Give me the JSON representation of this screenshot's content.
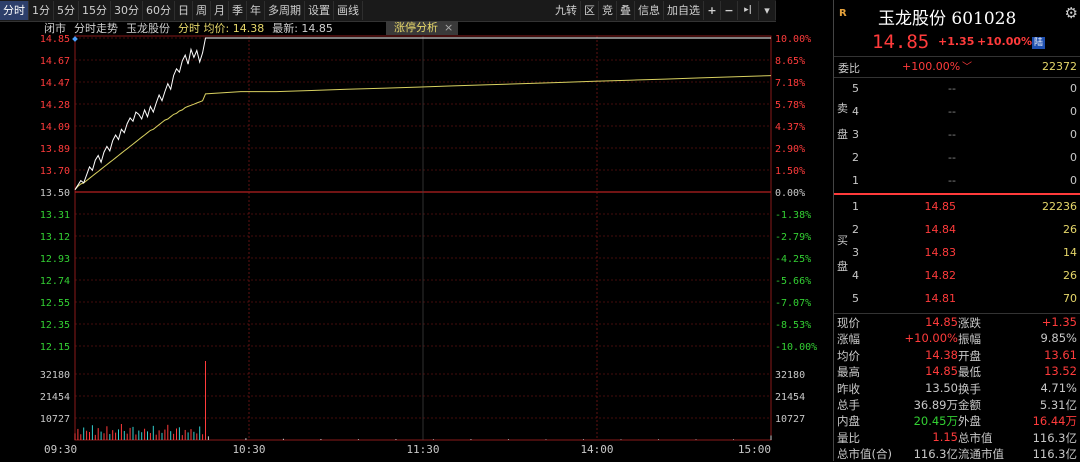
{
  "toolbar": {
    "left": [
      {
        "label": "分时",
        "active": true
      },
      {
        "label": "1分"
      },
      {
        "label": "5分"
      },
      {
        "label": "15分"
      },
      {
        "label": "30分"
      },
      {
        "label": "60分"
      },
      {
        "label": "日"
      },
      {
        "label": "周"
      },
      {
        "label": "月"
      },
      {
        "label": "季"
      },
      {
        "label": "年"
      },
      {
        "label": "多周期"
      },
      {
        "label": "设置"
      },
      {
        "label": "画线"
      }
    ],
    "right": [
      {
        "label": "九转"
      },
      {
        "label": "区"
      },
      {
        "label": "竞"
      },
      {
        "label": "叠"
      },
      {
        "label": "信息"
      },
      {
        "label": "加自选"
      }
    ],
    "icons": {
      "plus": "+",
      "minus": "−",
      "skip": "▸|",
      "menu": "▾"
    }
  },
  "infoline": {
    "status": "闭市",
    "mode": "分时走势",
    "name": "玉龙股份",
    "avg_label": "分时 均价: 14.38",
    "latest_label": "最新: 14.85"
  },
  "limitup_tab": {
    "label": "涨停分析",
    "close": "×"
  },
  "chart_data": {
    "type": "line",
    "price_axis": {
      "labels": [
        "14.85",
        "14.67",
        "14.47",
        "14.28",
        "14.09",
        "13.89",
        "13.70",
        "13.50",
        "13.31",
        "13.12",
        "12.93",
        "12.74",
        "12.55",
        "12.35",
        "12.15"
      ],
      "min": 12.15,
      "max": 14.85,
      "prev_close": 13.5
    },
    "pct_axis": {
      "labels": [
        "10.00%",
        "8.65%",
        "7.18%",
        "5.78%",
        "4.37%",
        "2.90%",
        "1.50%",
        "0.00%",
        "-1.38%",
        "-2.79%",
        "-4.25%",
        "-5.66%",
        "-7.07%",
        "-8.53%",
        "-10.00%"
      ]
    },
    "volume_axis": {
      "labels": [
        "32180",
        "21454",
        "10727"
      ],
      "max": 42907
    },
    "time_axis": {
      "labels": [
        "09:30",
        "10:30",
        "11:30",
        "14:00",
        "15:00"
      ]
    },
    "price": [
      13.52,
      13.56,
      13.6,
      13.58,
      13.65,
      13.72,
      13.69,
      13.78,
      13.82,
      13.76,
      13.85,
      13.9,
      13.86,
      13.95,
      14.0,
      13.96,
      14.05,
      14.02,
      14.1,
      14.15,
      14.12,
      14.2,
      14.18,
      14.14,
      14.22,
      14.16,
      14.25,
      14.2,
      14.28,
      14.35,
      14.3,
      14.38,
      14.45,
      14.4,
      14.52,
      14.58,
      14.55,
      14.65,
      14.7,
      14.62,
      14.75,
      14.68,
      14.74,
      14.64,
      14.72,
      14.85,
      14.85,
      14.85,
      14.85,
      14.85
    ],
    "average": [
      13.52,
      13.55,
      13.57,
      13.58,
      13.6,
      13.62,
      13.64,
      13.66,
      13.68,
      13.7,
      13.72,
      13.74,
      13.76,
      13.78,
      13.8,
      13.82,
      13.84,
      13.86,
      13.88,
      13.9,
      13.92,
      13.94,
      13.96,
      13.98,
      14.0,
      14.02,
      14.04,
      14.05,
      14.07,
      14.09,
      14.11,
      14.13,
      14.14,
      14.16,
      14.18,
      14.19,
      14.21,
      14.22,
      14.24,
      14.25,
      14.26,
      14.27,
      14.28,
      14.29,
      14.3,
      14.36,
      14.38,
      14.38,
      14.39,
      14.4,
      14.41,
      14.42,
      14.43,
      14.44,
      14.45,
      14.46,
      14.47,
      14.48,
      14.49,
      14.5,
      14.51,
      14.52
    ],
    "volume": [
      3200,
      5400,
      2800,
      6100,
      4500,
      3900,
      7200,
      2500,
      5800,
      4100,
      3300,
      6700,
      2900,
      4800,
      3600,
      5200,
      7800,
      4400,
      3100,
      5900,
      6400,
      2700,
      4600,
      3800,
      5500,
      4200,
      3400,
      6900,
      2600,
      4700,
      3500,
      5100,
      7400,
      4300,
      3000,
      5600,
      6200,
      2400,
      4900,
      3700,
      5300,
      4000,
      3200,
      6600,
      2800,
      38500,
      1800,
      900,
      600,
      500,
      400,
      450,
      350,
      420,
      380,
      300,
      360,
      320,
      340,
      310,
      330,
      2200
    ]
  },
  "panel": {
    "r_tag": "R",
    "title": "玉龙股份 601028",
    "price": "14.85",
    "change": "+1.35",
    "change_pct": "+10.00%",
    "limit_tag": "陆",
    "ratio": {
      "label": "委比",
      "value": "+100.00%",
      "net": "22372"
    },
    "sell_label": [
      "卖",
      "盘"
    ],
    "buy_label": [
      "买",
      "盘"
    ],
    "sell": [
      {
        "level": "5",
        "price": "--",
        "vol": "0"
      },
      {
        "level": "4",
        "price": "--",
        "vol": "0"
      },
      {
        "level": "3",
        "price": "--",
        "vol": "0"
      },
      {
        "level": "2",
        "price": "--",
        "vol": "0"
      },
      {
        "level": "1",
        "price": "--",
        "vol": "0"
      }
    ],
    "buy": [
      {
        "level": "1",
        "price": "14.85",
        "vol": "22236"
      },
      {
        "level": "2",
        "price": "14.84",
        "vol": "26"
      },
      {
        "level": "3",
        "price": "14.83",
        "vol": "14"
      },
      {
        "level": "4",
        "price": "14.82",
        "vol": "26"
      },
      {
        "level": "5",
        "price": "14.81",
        "vol": "70"
      }
    ],
    "stats": [
      {
        "k1": "现价",
        "v1": "14.85",
        "c1": "red",
        "k2": "涨跌",
        "v2": "+1.35",
        "c2": "red"
      },
      {
        "k1": "涨幅",
        "v1": "+10.00%",
        "c1": "red",
        "k2": "振幅",
        "v2": "9.85%",
        "c2": "wht"
      },
      {
        "k1": "均价",
        "v1": "14.38",
        "c1": "red",
        "k2": "开盘",
        "v2": "13.61",
        "c2": "red"
      },
      {
        "k1": "最高",
        "v1": "14.85",
        "c1": "red",
        "k2": "最低",
        "v2": "13.52",
        "c2": "red"
      },
      {
        "k1": "昨收",
        "v1": "13.50",
        "c1": "wht",
        "k2": "换手",
        "v2": "4.71%",
        "c2": "wht"
      },
      {
        "k1": "总手",
        "v1": "36.89万",
        "c1": "wht",
        "k2": "金额",
        "v2": "5.31亿",
        "c2": "wht"
      },
      {
        "k1": "内盘",
        "v1": "20.45万",
        "c1": "grn",
        "k2": "外盘",
        "v2": "16.44万",
        "c2": "red"
      },
      {
        "k1": "量比",
        "v1": "1.15",
        "c1": "red",
        "k2": "总市值",
        "v2": "116.3亿",
        "c2": "wht"
      },
      {
        "k1": "总市值(合)",
        "v1": "116.3亿",
        "c1": "wht",
        "k2": "流通市值",
        "v2": "116.3亿",
        "c2": "wht"
      }
    ]
  }
}
